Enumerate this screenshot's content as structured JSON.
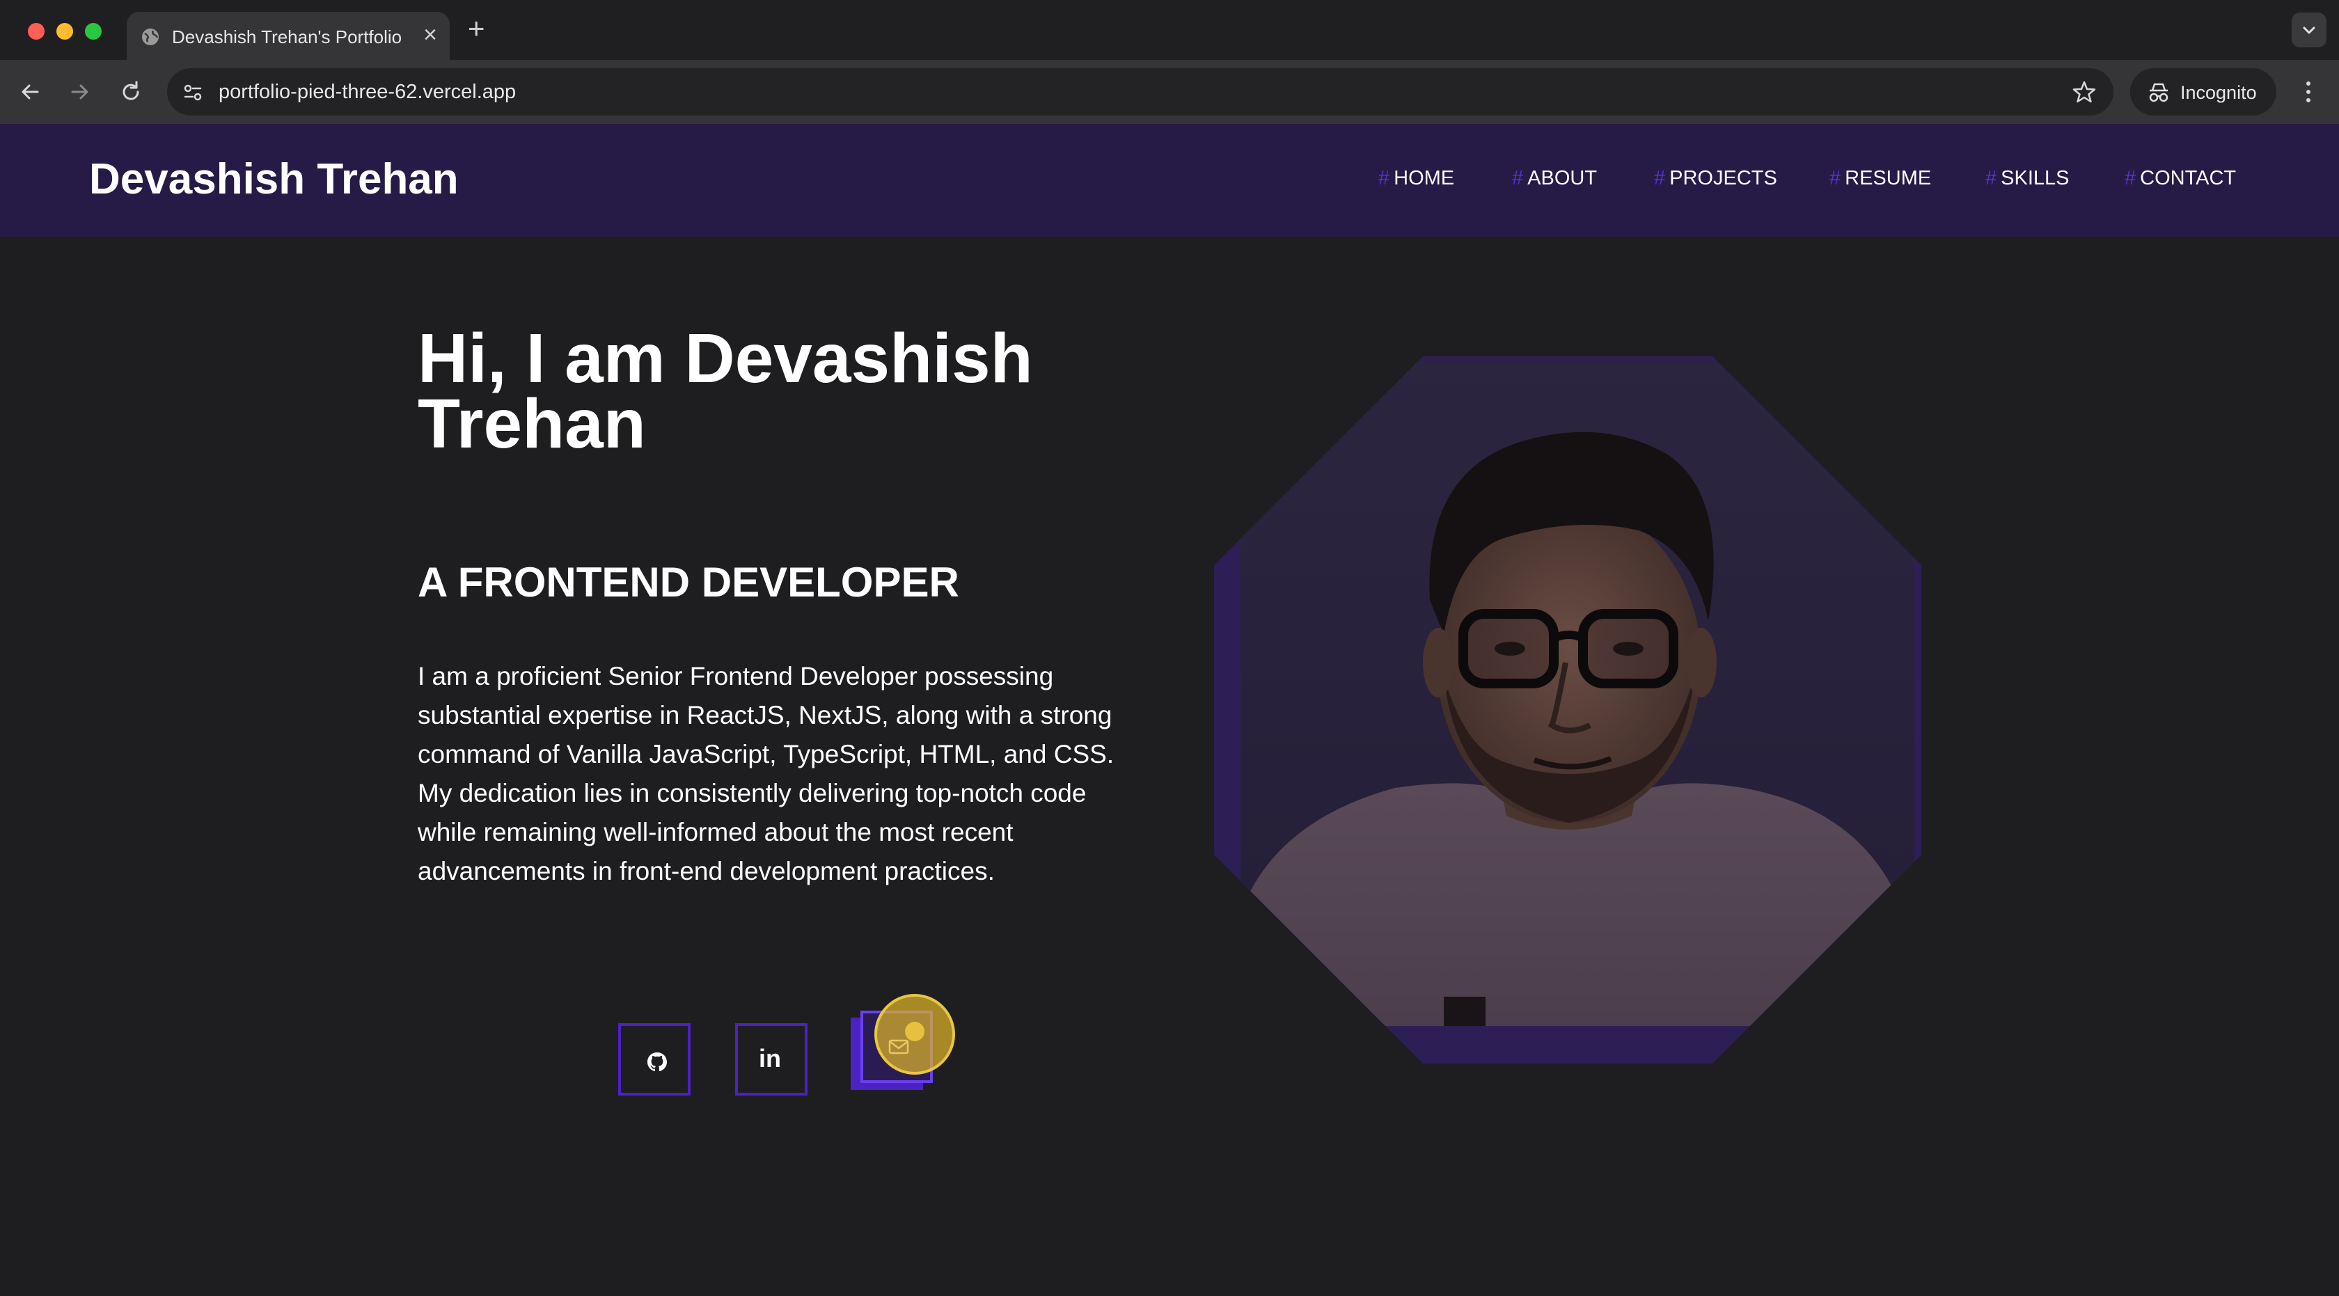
{
  "browser": {
    "tab_title": "Devashish Trehan's Portfolio",
    "url": "portfolio-pied-three-62.vercel.app",
    "incognito_label": "Incognito"
  },
  "header": {
    "brand": "Devashish Trehan",
    "nav": [
      {
        "hash": "#",
        "label": "HOME"
      },
      {
        "hash": "#",
        "label": "ABOUT"
      },
      {
        "hash": "#",
        "label": "PROJECTS"
      },
      {
        "hash": "#",
        "label": "RESUME"
      },
      {
        "hash": "#",
        "label": "SKILLS"
      },
      {
        "hash": "#",
        "label": "CONTACT"
      }
    ]
  },
  "hero": {
    "title": "Hi, I am Devashish Trehan",
    "subtitle": "A FRONTEND DEVELOPER",
    "body": "I am a proficient Senior Frontend Developer possessing substantial expertise in ReactJS, NextJS, along with a strong command of Vanilla JavaScript, TypeScript, HTML, and CSS. My dedication lies in consistently delivering top-notch code while remaining well-informed about the most recent advancements in front-end development practices."
  },
  "social": {
    "icons": [
      "github-icon",
      "linkedin-icon",
      "mail-icon"
    ],
    "linkedin_text": "in"
  },
  "colors": {
    "header_bg": "#261a47",
    "page_bg": "#1e1e20",
    "accent": "#4b22c4",
    "hash": "#5b2fd6"
  }
}
